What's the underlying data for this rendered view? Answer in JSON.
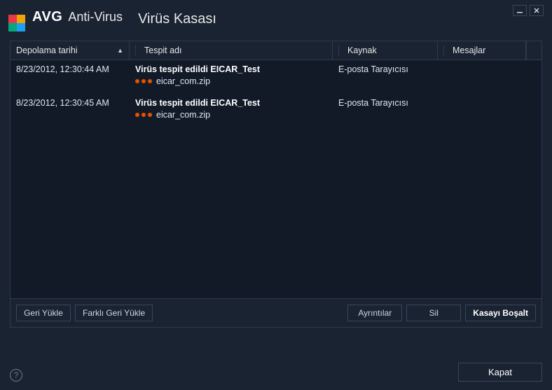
{
  "header": {
    "brand": "AVG",
    "product": "Anti-Virus",
    "window_title": "Virüs Kasası"
  },
  "columns": {
    "date": "Depolama tarihi",
    "name": "Tespit adı",
    "source": "Kaynak",
    "messages": "Mesajlar"
  },
  "rows": [
    {
      "date": "8/23/2012, 12:30:44 AM",
      "detection": "Virüs tespit edildi EICAR_Test",
      "file": "eicar_com.zip",
      "source": "E-posta Tarayıcısı",
      "messages": ""
    },
    {
      "date": "8/23/2012, 12:30:45 AM",
      "detection": "Virüs tespit edildi EICAR_Test",
      "file": "eicar_com.zip",
      "source": "E-posta Tarayıcısı",
      "messages": ""
    }
  ],
  "buttons": {
    "restore": "Geri Yükle",
    "restore_as": "Farklı Geri Yükle",
    "details": "Ayrıntılar",
    "delete": "Sil",
    "empty_vault": "Kasayı Boşalt",
    "close": "Kapat"
  }
}
